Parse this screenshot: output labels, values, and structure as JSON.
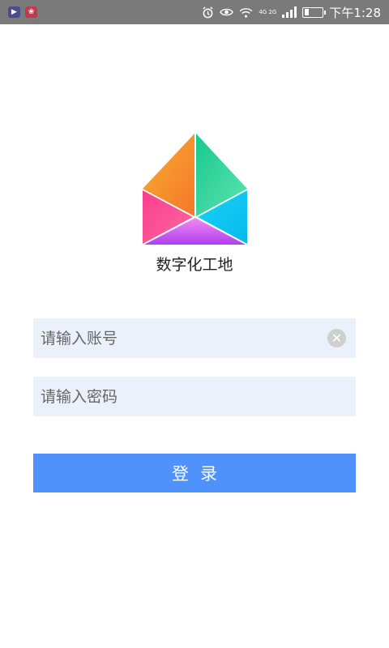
{
  "status_bar": {
    "time": "下午1:28",
    "network": "4G 2G",
    "battery_level": 0.25,
    "icons": [
      "app-notification-icon",
      "huawei-notification-icon",
      "alarm-icon",
      "eye-comfort-icon",
      "wifi-icon",
      "signal-icon",
      "battery-icon"
    ]
  },
  "app": {
    "name": "数字化工地"
  },
  "form": {
    "account_placeholder": "请输入账号",
    "account_value": "",
    "password_placeholder": "请输入密码",
    "password_value": "",
    "clear_icon": "✕",
    "login_label": "登录"
  },
  "colors": {
    "field_background": "#ebf1fa",
    "login_button": "#5092fb",
    "status_bar": "#7a7a7a"
  }
}
